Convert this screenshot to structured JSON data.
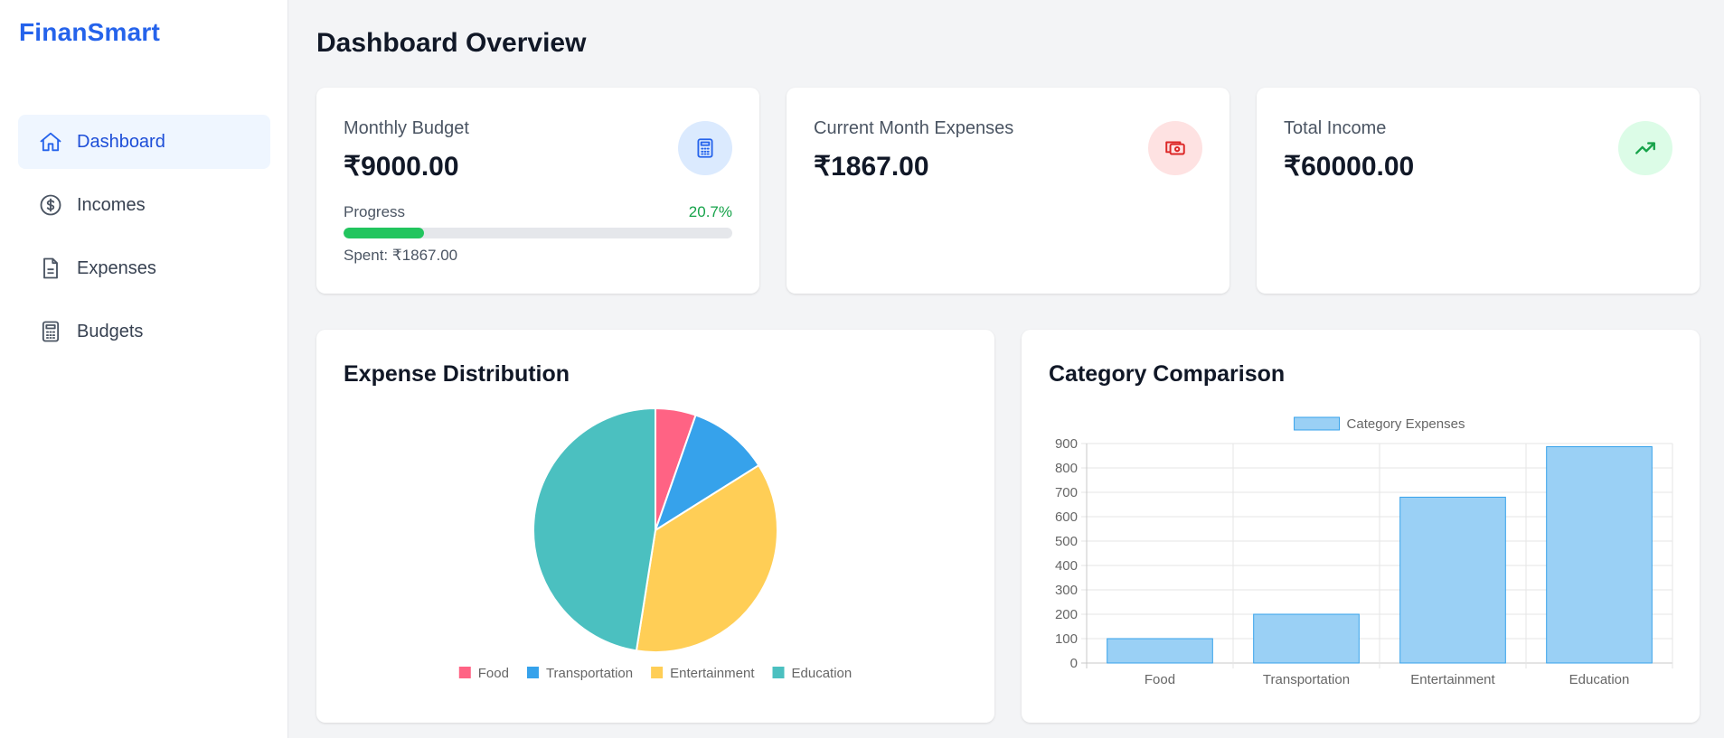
{
  "app": {
    "name": "FinanSmart"
  },
  "sidebar": {
    "items": [
      {
        "label": "Dashboard",
        "icon": "home-icon",
        "active": true
      },
      {
        "label": "Incomes",
        "icon": "dollar-circle-icon",
        "active": false
      },
      {
        "label": "Expenses",
        "icon": "document-icon",
        "active": false
      },
      {
        "label": "Budgets",
        "icon": "calculator-icon",
        "active": false
      }
    ]
  },
  "page": {
    "title": "Dashboard Overview"
  },
  "cards": {
    "budget": {
      "label": "Monthly Budget",
      "value": "₹9000.00",
      "icon": "calculator-icon",
      "progress_label": "Progress",
      "progress_pct": "20.7%",
      "progress_fraction": 0.207,
      "spent": "Spent: ₹1867.00"
    },
    "expenses": {
      "label": "Current Month Expenses",
      "value": "₹1867.00",
      "icon": "cash-icon"
    },
    "income": {
      "label": "Total Income",
      "value": "₹60000.00",
      "icon": "trending-up-icon"
    }
  },
  "colors": {
    "brand": "#2563eb",
    "progress": "#22c55e",
    "food": "#ff6384",
    "transportation": "#36a2eb",
    "entertainment": "#ffce56",
    "education": "#4bc0c0",
    "bar_fill": "#9ad0f5",
    "bar_stroke": "#36a2eb"
  },
  "panels": {
    "distribution": {
      "title": "Expense Distribution"
    },
    "comparison": {
      "title": "Category Comparison"
    }
  },
  "chart_data": [
    {
      "type": "pie",
      "title": "Expense Distribution",
      "categories": [
        "Food",
        "Transportation",
        "Entertainment",
        "Education"
      ],
      "values": [
        100,
        200,
        680,
        887
      ],
      "colors": [
        "#ff6384",
        "#36a2eb",
        "#ffce56",
        "#4bc0c0"
      ],
      "legend": "bottom"
    },
    {
      "type": "bar",
      "title": "Category Comparison",
      "categories": [
        "Food",
        "Transportation",
        "Entertainment",
        "Education"
      ],
      "series": [
        {
          "name": "Category Expenses",
          "values": [
            100,
            200,
            680,
            887
          ]
        }
      ],
      "ylim": [
        0,
        900
      ],
      "yticks": [
        0,
        100,
        200,
        300,
        400,
        500,
        600,
        700,
        800,
        900
      ],
      "grid": true,
      "legend": "top"
    }
  ]
}
